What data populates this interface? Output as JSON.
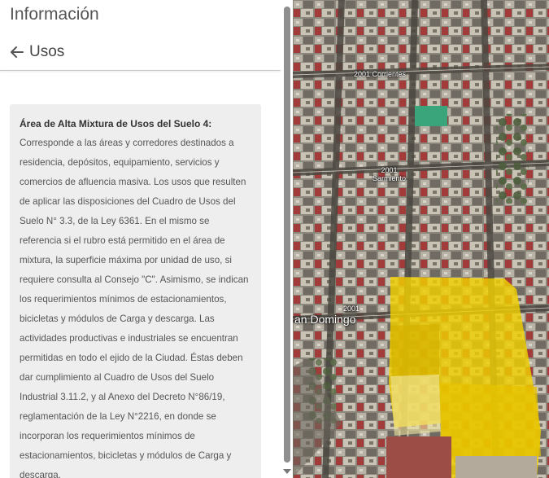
{
  "panel": {
    "title": "Información",
    "back_label": "Usos",
    "heading": "Área de Alta Mixtura de Usos del Suelo 4:",
    "body": "Corresponde a las áreas y corredores destinados a residencia, depósitos, equipamiento, servicios y comercios de afluencia masiva. Los usos que resulten de aplicar las disposiciones del Cuadro de Usos del Suelo N° 3.3, de la Ley 6361. En el mismo se referencia si el rubro está permitido en el área de mixtura, la superficie máxima por unidad de uso, si requiere consulta al Consejo \"C\". Asimismo, se indican los requerimientos mínimos de estacionamientos, bicicletas y módulos de Carga y descarga. Las actividades productivas e industriales se encuentran permitidas en todo el ejido de la Ciudad. Éstas deben dar cumplimiento al Cuadro de Usos del Suelo Industrial 3.11.2, y al Anexo del Decreto N°86/19, reglamentación de la Ley N°2216, en donde se incorporan los requerimientos mínimos de estacionamientos, bicicletas y módulos de Carga y descarga."
  },
  "map": {
    "labels": {
      "street1_number": "2001",
      "street1_name": "Corrientes",
      "street2_number": "2001",
      "street2_name": "Sarmiento",
      "street3_number": "2001",
      "street3_name": "an Domingo"
    },
    "highlight_color": "#f2cf00"
  }
}
